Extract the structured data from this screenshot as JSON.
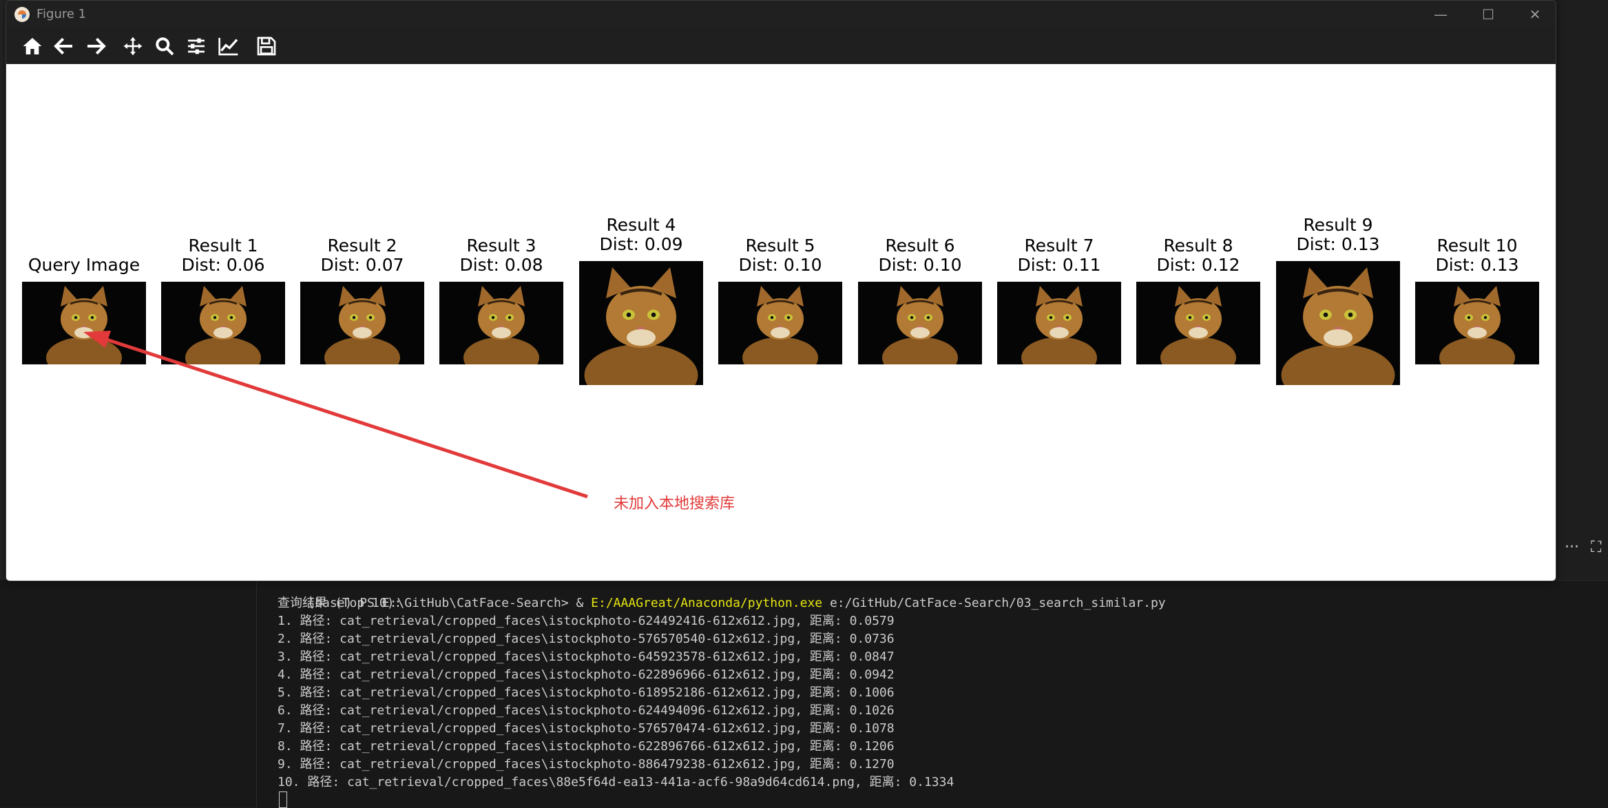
{
  "window": {
    "title": "Figure 1",
    "controls": {
      "minimize": "—",
      "maximize": "☐",
      "close": "✕"
    }
  },
  "toolbar": {
    "tools": [
      "home-icon",
      "back-arrow-icon",
      "forward-arrow-icon",
      "pan-move-icon",
      "zoom-magnifier-icon",
      "subplots-config-icon",
      "axes-edit-icon",
      "save-floppy-icon"
    ]
  },
  "figure": {
    "panels": [
      {
        "title": "Query Image",
        "dist": ""
      },
      {
        "title": "Result 1",
        "dist": "Dist: 0.06"
      },
      {
        "title": "Result 2",
        "dist": "Dist: 0.07"
      },
      {
        "title": "Result 3",
        "dist": "Dist: 0.08"
      },
      {
        "title": "Result 4",
        "dist": "Dist: 0.09"
      },
      {
        "title": "Result 5",
        "dist": "Dist: 0.10"
      },
      {
        "title": "Result 6",
        "dist": "Dist: 0.10"
      },
      {
        "title": "Result 7",
        "dist": "Dist: 0.11"
      },
      {
        "title": "Result 8",
        "dist": "Dist: 0.12"
      },
      {
        "title": "Result 9",
        "dist": "Dist: 0.13"
      },
      {
        "title": "Result 10",
        "dist": "Dist: 0.13"
      }
    ],
    "annotation": "未加入本地搜索库",
    "annotation_color": "#e23a3a"
  },
  "terminal": {
    "prompt_prefix": "(base) PS E:\\GitHub\\CatFace-Search> & ",
    "prompt_exe": "E:/AAAGreat/Anaconda/python.exe",
    "prompt_script": " e:/GitHub/CatFace-Search/03_search_similar.py",
    "header": "查询结果 (Top 10):",
    "results": [
      "1. 路径: cat_retrieval/cropped_faces\\istockphoto-624492416-612x612.jpg, 距离: 0.0579",
      "2. 路径: cat_retrieval/cropped_faces\\istockphoto-576570540-612x612.jpg, 距离: 0.0736",
      "3. 路径: cat_retrieval/cropped_faces\\istockphoto-645923578-612x612.jpg, 距离: 0.0847",
      "4. 路径: cat_retrieval/cropped_faces\\istockphoto-622896966-612x612.jpg, 距离: 0.0942",
      "5. 路径: cat_retrieval/cropped_faces\\istockphoto-618952186-612x612.jpg, 距离: 0.1006",
      "6. 路径: cat_retrieval/cropped_faces\\istockphoto-624494096-612x612.jpg, 距离: 0.1026",
      "7. 路径: cat_retrieval/cropped_faces\\istockphoto-576570474-612x612.jpg, 距离: 0.1078",
      "8. 路径: cat_retrieval/cropped_faces\\istockphoto-622896766-612x612.jpg, 距离: 0.1206",
      "9. 路径: cat_retrieval/cropped_faces\\istockphoto-886479238-612x612.jpg, 距离: 0.1270",
      "10. 路径: cat_retrieval/cropped_faces\\88e5f64d-ea13-441a-acf6-98a9d64cd614.png, 距离: 0.1334"
    ]
  },
  "editor": {
    "more_actions": "···"
  }
}
